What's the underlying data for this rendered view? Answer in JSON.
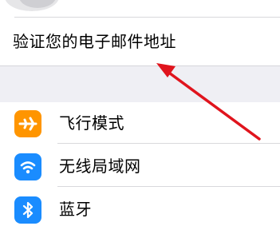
{
  "account": {
    "verify_email_label": "验证您的电子邮件地址"
  },
  "settings": {
    "items": [
      {
        "label": "飞行模式",
        "icon": "airplane-icon",
        "color": "#ff9500"
      },
      {
        "label": "无线局域网",
        "icon": "wifi-icon",
        "color": "#1a8cff"
      },
      {
        "label": "蓝牙",
        "icon": "bluetooth-icon",
        "color": "#1a8cff"
      }
    ]
  },
  "annotation": {
    "arrow_color": "#e0141d"
  }
}
